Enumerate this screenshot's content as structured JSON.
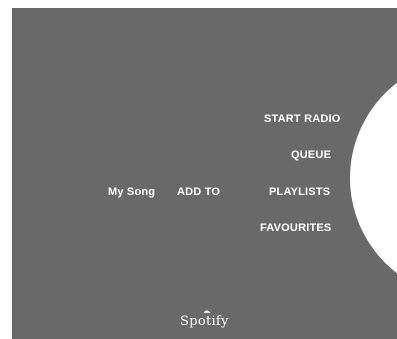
{
  "screen": {
    "background_color": "#696969",
    "disc_color": "#ffffff"
  },
  "track": {
    "title": "My Song"
  },
  "menu": {
    "add_to_label": "ADD TO",
    "start_radio_label": "START RADIO",
    "queue_label": "QUEUE",
    "playlists_label": "PLAYLISTS",
    "favourites_label": "FAVOURITES"
  },
  "branding": {
    "logo_text": "Spotify"
  }
}
